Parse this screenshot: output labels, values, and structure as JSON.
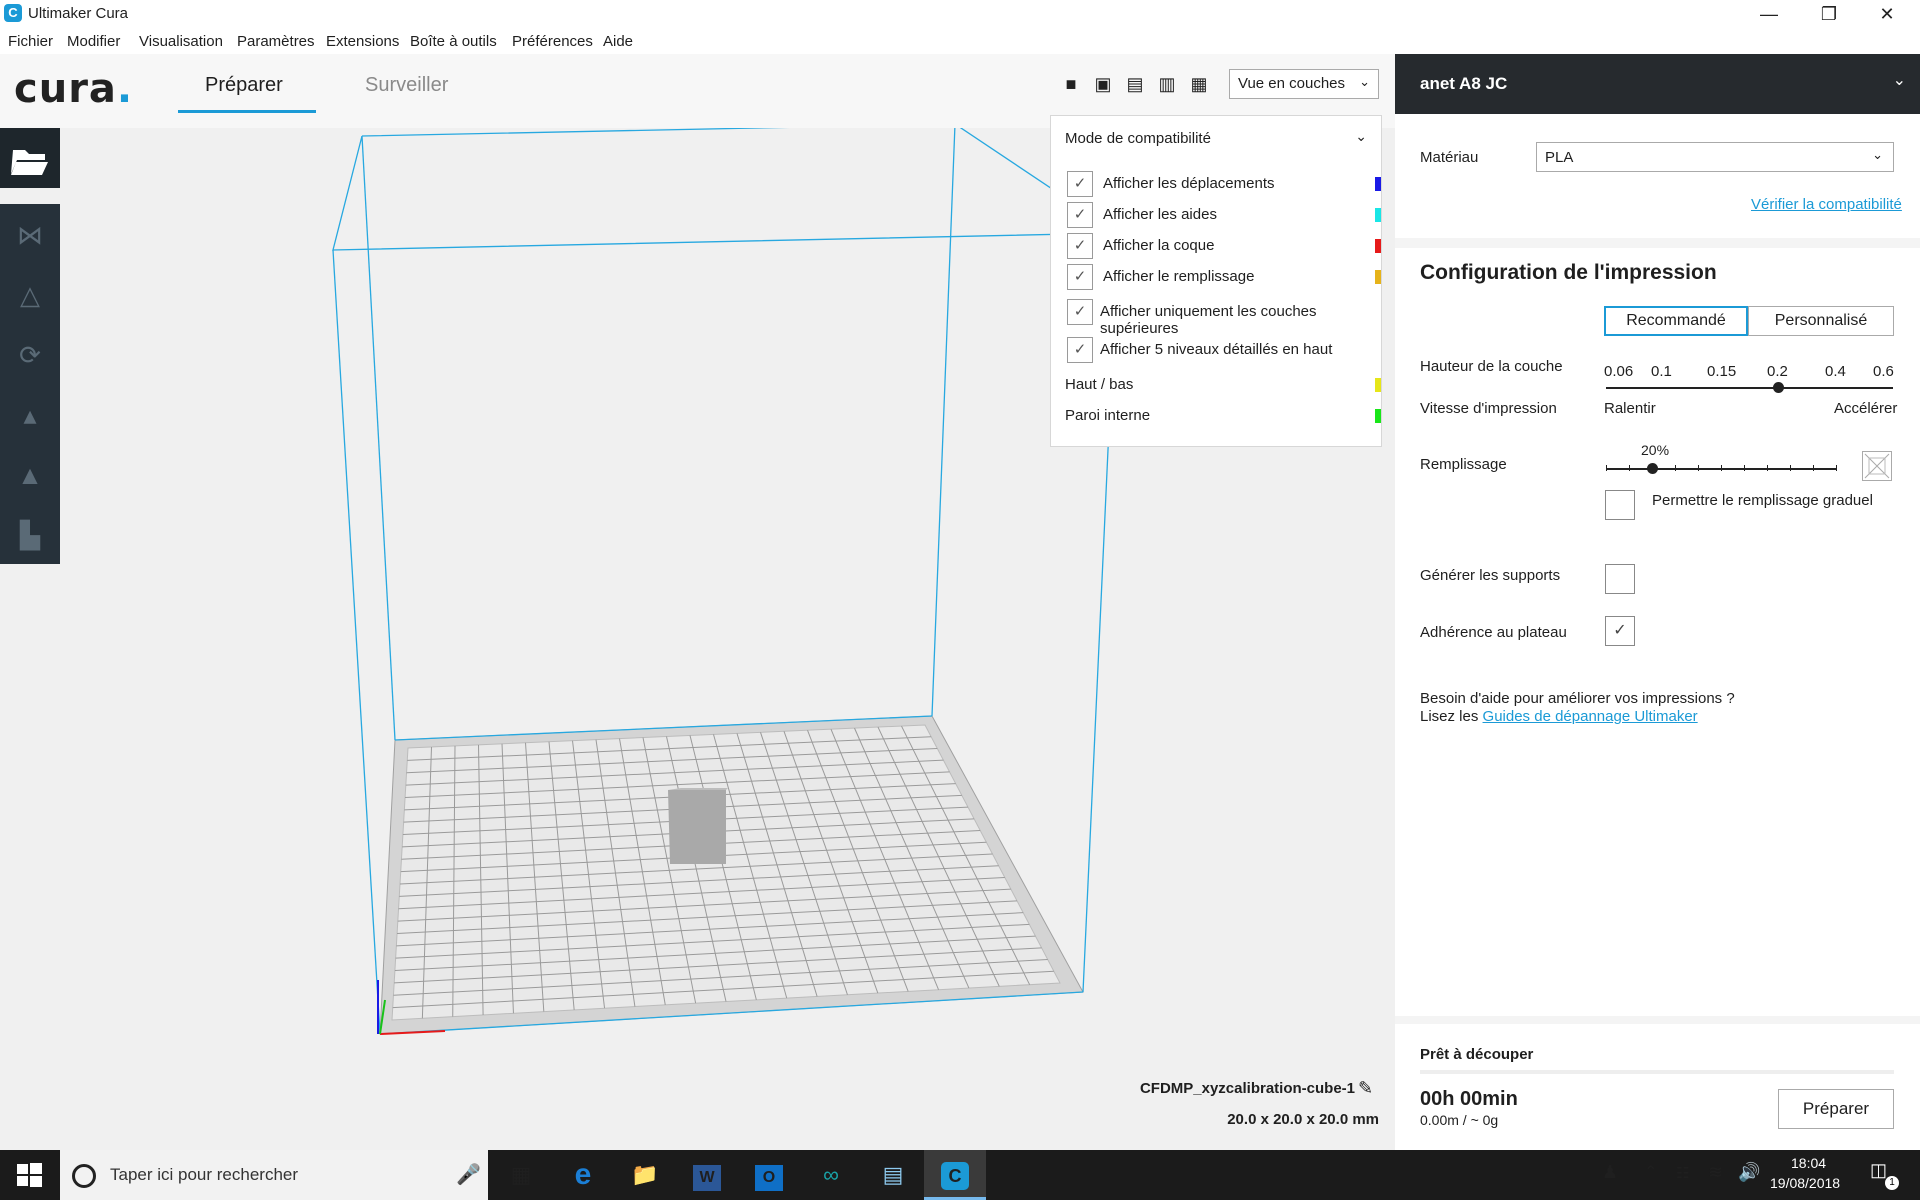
{
  "window": {
    "title": "Ultimaker Cura",
    "app_icon_letter": "C",
    "controls": {
      "minimize": "—",
      "maximize": "❐",
      "close": "✕"
    }
  },
  "menu": [
    "Fichier",
    "Modifier",
    "Visualisation",
    "Paramètres",
    "Extensions",
    "Boîte à outils",
    "Préférences",
    "Aide"
  ],
  "header": {
    "logo": "cura",
    "tabs": [
      {
        "label": "Préparer",
        "active": true
      },
      {
        "label": "Surveiller",
        "active": false
      }
    ],
    "view_icons": [
      "3d-view-icon",
      "front-view-icon",
      "top-view-icon",
      "left-view-icon",
      "right-view-icon"
    ],
    "view_select": "Vue en couches"
  },
  "layer_panel": {
    "mode": "Mode de compatibilité",
    "options": [
      {
        "label": "Afficher les déplacements",
        "checked": true,
        "color": "#1a1ae6"
      },
      {
        "label": "Afficher les aides",
        "checked": true,
        "color": "#19e6e6"
      },
      {
        "label": "Afficher la coque",
        "checked": true,
        "color": "#e61a1a"
      },
      {
        "label": "Afficher le remplissage",
        "checked": true,
        "color": "#e6b31a"
      },
      {
        "label": "Afficher uniquement les couches supérieures",
        "checked": true,
        "color": ""
      },
      {
        "label": "Afficher 5 niveaux détaillés en haut",
        "checked": true,
        "color": ""
      }
    ],
    "legend": [
      {
        "label": "Haut / bas",
        "color": "#e6e619"
      },
      {
        "label": "Paroi interne",
        "color": "#19e619"
      }
    ]
  },
  "model": {
    "name": "CFDMP_xyzcalibration-cube-1",
    "dimensions": "20.0 x 20.0 x 20.0 mm"
  },
  "printer": {
    "name": "anet A8 JC",
    "material_label": "Matériau",
    "material_value": "PLA",
    "check_compat": "Vérifier la compatibilité"
  },
  "print_config": {
    "title": "Configuration de l'impression",
    "mode_recommended": "Recommandé",
    "mode_custom": "Personnalisé",
    "layer_height_label": "Hauteur de la couche",
    "layer_heights": [
      "0.06",
      "0.1",
      "0.15",
      "0.2",
      "0.4",
      "0.6"
    ],
    "layer_height_selected": "0.2",
    "speed_label": "Vitesse d'impression",
    "speed_slow": "Ralentir",
    "speed_fast": "Accélérer",
    "infill_label": "Remplissage",
    "infill_value": "20%",
    "infill_fraction": 0.2,
    "gradual_infill_label": "Permettre le remplissage graduel",
    "gradual_infill_checked": false,
    "support_label": "Générer les supports",
    "support_checked": false,
    "adhesion_label": "Adhérence au plateau",
    "adhesion_checked": true,
    "help_line1": "Besoin d'aide pour améliorer vos impressions ?",
    "help_line2_prefix": "Lisez les",
    "help_link": "Guides de dépannage Ultimaker"
  },
  "slice": {
    "status": "Prêt à découper",
    "time": "00h 00min",
    "material": "0.00m / ~ 0g",
    "button": "Préparer"
  },
  "taskbar": {
    "search_placeholder": "Taper ici pour rechercher",
    "time": "18:04",
    "date": "19/08/2018",
    "notification_count": "1"
  }
}
